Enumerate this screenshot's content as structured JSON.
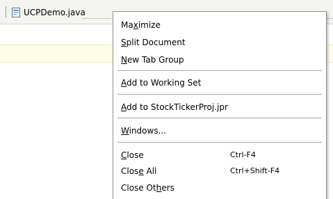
{
  "tab": {
    "label": "UCPDemo.java"
  },
  "menu": {
    "maximize": {
      "pre": "Ma",
      "acc": "x",
      "post": "imize"
    },
    "split": {
      "pre": "",
      "acc": "S",
      "post": "plit Document"
    },
    "newgroup": {
      "pre": "",
      "acc": "N",
      "post": "ew Tab Group"
    },
    "addws": {
      "pre": "",
      "acc": "A",
      "post": "dd to Working Set"
    },
    "addproj": {
      "pre": "",
      "acc": "A",
      "post": "dd to StockTickerProj.jpr"
    },
    "windows": {
      "pre": "",
      "acc": "W",
      "post": "indows..."
    },
    "close": {
      "pre": "",
      "acc": "C",
      "post": "lose",
      "shortcut": "Ctrl-F4"
    },
    "closeall": {
      "pre": "Clos",
      "acc": "e",
      "post": " All",
      "shortcut": "Ctrl+Shift-F4"
    },
    "closeothers": {
      "pre": "Close Ot",
      "acc": "h",
      "post": "ers"
    }
  },
  "colors": {
    "highlight_band": "#fffde8",
    "menu_border": "#8f8f8f"
  },
  "icons": {
    "file": "java-file-icon"
  }
}
